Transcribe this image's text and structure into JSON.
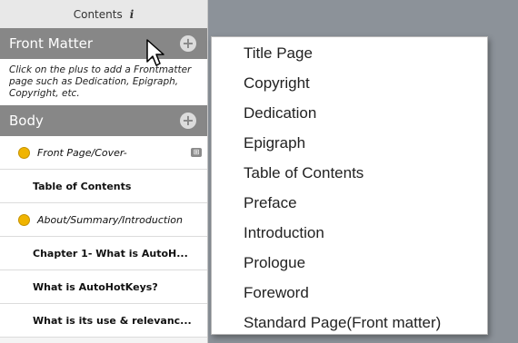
{
  "sidebar": {
    "header_title": "Contents",
    "info_icon": "i",
    "front_matter": {
      "title": "Front Matter",
      "add_icon": "+",
      "hint": "Click on the plus to add a Frontmatter page such as Dedication, Epigraph, Copyright, etc."
    },
    "body": {
      "title": "Body",
      "add_icon": "+",
      "items": [
        {
          "label": "Front Page/Cover-",
          "status": "dot-yellow"
        },
        {
          "label": "Table of Contents"
        },
        {
          "label": "About/Summary/Introduction",
          "status": "dot-yellow"
        },
        {
          "label": "Chapter 1- What is AutoH..."
        },
        {
          "label": "What is AutoHotKeys?"
        },
        {
          "label": "What is its use & relevanc..."
        }
      ]
    }
  },
  "dropdown": {
    "items": [
      "Title Page",
      "Copyright",
      "Dedication",
      "Epigraph",
      "Table of Contents",
      "Preface",
      "Introduction",
      "Prologue",
      "Foreword",
      "Standard Page(Front matter)"
    ]
  }
}
